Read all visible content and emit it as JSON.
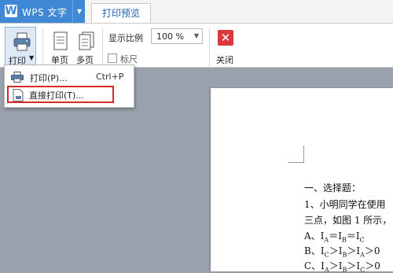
{
  "app": {
    "title": "WPS 文字"
  },
  "tabs": {
    "print_preview": "打印预览"
  },
  "ribbon": {
    "print_label": "打印",
    "single_page_label": "单页",
    "multi_page_label": "多页",
    "zoom_label": "显示比例",
    "zoom_value": "100 %",
    "ruler_label": "标尺",
    "close_label": "关闭"
  },
  "menu": {
    "print_label": "打印(P)...",
    "print_shortcut": "Ctrl+P",
    "direct_print_label": "直接打印(T)..."
  },
  "document": {
    "lines": [
      "一、选择题：",
      "1、小明同学在使用",
      "三点，如图 1 所示，",
      "A、I_A＝I_B＝I_C",
      "B、I_C＞I_B＞I_A＞0",
      "C、I_A＞I_B＞I_C＞0"
    ]
  },
  "colors": {
    "accent": "#3e88d6",
    "highlight": "#d92a2a",
    "workspace": "#9aa3ad",
    "close": "#d9393e"
  },
  "icons": [
    "w-logo-icon",
    "dropdown-arrow-icon",
    "printer-icon",
    "single-page-icon",
    "multi-page-icon",
    "close-icon",
    "direct-print-icon"
  ]
}
